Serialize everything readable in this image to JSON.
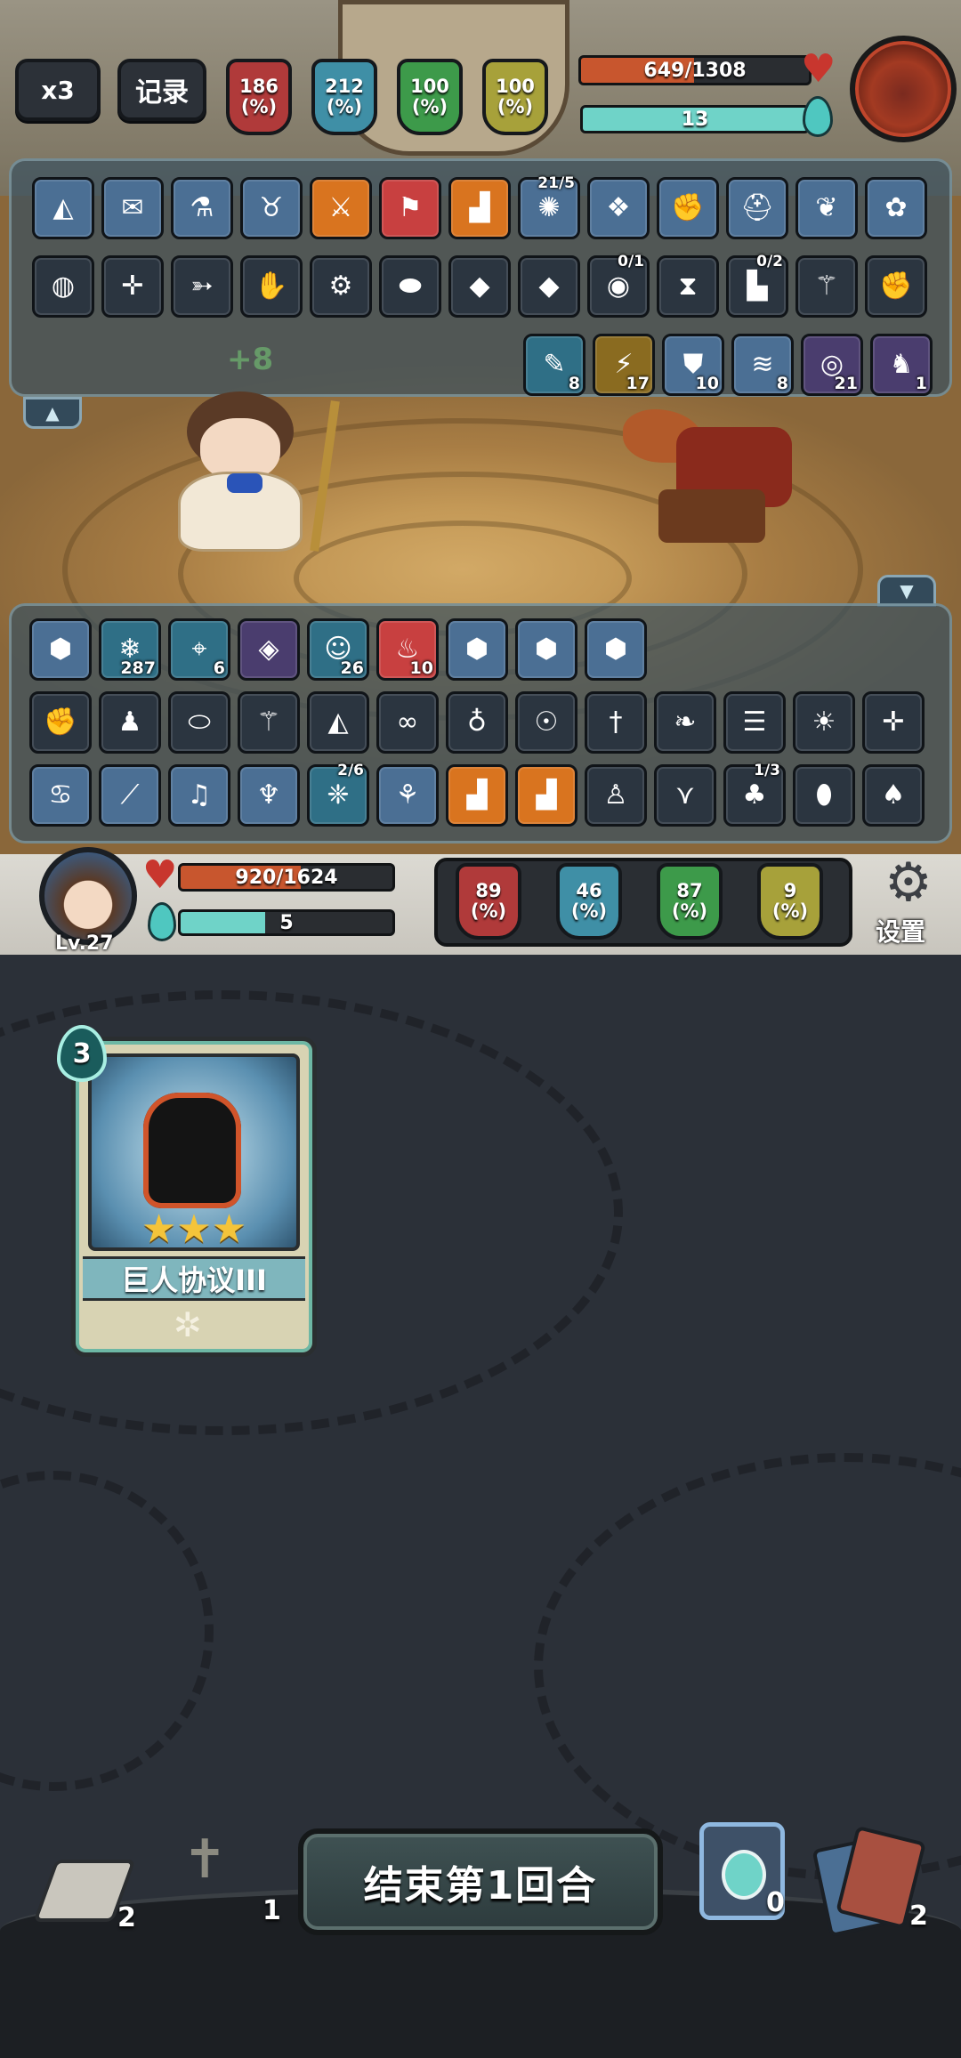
{
  "top": {
    "speed_label": "x3",
    "log_label": "记录",
    "enemy_stats": [
      {
        "value": "186",
        "unit": "(%)",
        "color": "#b03a3a",
        "icon": "attack-icon"
      },
      {
        "value": "212",
        "unit": "(%)",
        "color": "#3f8fa6",
        "icon": "crit-icon"
      },
      {
        "value": "100",
        "unit": "(%)",
        "color": "#3d9a4a",
        "icon": "defense-icon"
      },
      {
        "value": "100",
        "unit": "(%)",
        "color": "#a7a13a",
        "icon": "speed-icon"
      }
    ],
    "enemy_hp_text": "649/1308",
    "enemy_hp_ratio": 0.496,
    "enemy_energy_text": "13",
    "enemy_energy_ratio": 1.0
  },
  "enemy_panel": {
    "row1": [
      {
        "icon": "rice-ball-icon",
        "style": "blue"
      },
      {
        "icon": "scroll-icon",
        "style": "blue"
      },
      {
        "icon": "potion-icon",
        "style": "blue"
      },
      {
        "icon": "minotaur-icon",
        "style": "blue"
      },
      {
        "icon": "sword-icon",
        "style": "orange"
      },
      {
        "icon": "banner-icon",
        "style": "red"
      },
      {
        "icon": "boot-icon",
        "style": "orange"
      },
      {
        "icon": "swirl-icon",
        "style": "blue",
        "frac": "21/5"
      },
      {
        "icon": "rune-icon",
        "style": "blue"
      },
      {
        "icon": "fist-rune-icon",
        "style": "blue"
      },
      {
        "icon": "helmet-rune-icon",
        "style": "blue"
      },
      {
        "icon": "wing-rune-icon",
        "style": "blue"
      },
      {
        "icon": "fairy-rune-icon",
        "style": "blue"
      }
    ],
    "row2": [
      {
        "icon": "pumpkin-icon",
        "style": "dark"
      },
      {
        "icon": "crossbow-icon",
        "style": "dark"
      },
      {
        "icon": "fish-icon",
        "style": "dark"
      },
      {
        "icon": "red-glove-icon",
        "style": "dark"
      },
      {
        "icon": "robot-icon",
        "style": "dark"
      },
      {
        "icon": "red-capsule-icon",
        "style": "dark"
      },
      {
        "icon": "green-gem-icon",
        "style": "dark"
      },
      {
        "icon": "green-gem-icon",
        "style": "dark"
      },
      {
        "icon": "pacifier-icon",
        "style": "dark",
        "frac": "0/1"
      },
      {
        "icon": "hourglass-icon",
        "style": "dark"
      },
      {
        "icon": "boots-icon",
        "style": "dark",
        "frac": "0/2"
      },
      {
        "icon": "staff-icon",
        "style": "dark"
      },
      {
        "icon": "gauntlet-icon",
        "style": "dark"
      }
    ],
    "effects": [
      {
        "icon": "pen-icon",
        "count": "8",
        "style": "cyan"
      },
      {
        "icon": "lightning-icon",
        "count": "17",
        "style": "gold"
      },
      {
        "icon": "shield-icon",
        "count": "10",
        "style": "blue"
      },
      {
        "icon": "wave-icon",
        "count": "8",
        "style": "blue"
      },
      {
        "icon": "spiral-icon",
        "count": "21",
        "style": "purple"
      },
      {
        "icon": "strength-icon",
        "count": "1",
        "style": "purple"
      }
    ]
  },
  "battle": {
    "floating_text": "+8"
  },
  "player_panel": {
    "effects": [
      {
        "icon": "gem-shield-icon",
        "count": "",
        "style": "blue"
      },
      {
        "icon": "snowflake-icon",
        "count": "287",
        "style": "cyan"
      },
      {
        "icon": "target-icon",
        "count": "6",
        "style": "cyan"
      },
      {
        "icon": "crystal-icon",
        "count": "",
        "style": "purple"
      },
      {
        "icon": "face-icon",
        "count": "26",
        "style": "cyan"
      },
      {
        "icon": "rage-icon",
        "count": "10",
        "style": "red"
      },
      {
        "icon": "gem-shield-icon",
        "count": "",
        "style": "blue"
      },
      {
        "icon": "gem-shield-icon",
        "count": "",
        "style": "blue"
      },
      {
        "icon": "gem-shield-icon",
        "count": "",
        "style": "blue"
      }
    ],
    "row2": [
      {
        "icon": "gauntlet-icon",
        "style": "dark"
      },
      {
        "icon": "figure-icon",
        "style": "dark"
      },
      {
        "icon": "bread-icon",
        "style": "dark"
      },
      {
        "icon": "staff-icon",
        "style": "dark"
      },
      {
        "icon": "rice-ball-icon",
        "style": "dark"
      },
      {
        "icon": "goggles-icon",
        "style": "dark"
      },
      {
        "icon": "bottle-icon",
        "style": "dark"
      },
      {
        "icon": "owl-icon",
        "style": "dark"
      },
      {
        "icon": "dagger-icon",
        "style": "dark"
      },
      {
        "icon": "leaf-icon",
        "style": "dark"
      },
      {
        "icon": "mummy-icon",
        "style": "dark"
      },
      {
        "icon": "sun-orb-icon",
        "style": "dark"
      },
      {
        "icon": "crossbow-icon",
        "style": "dark"
      }
    ],
    "row3": [
      {
        "icon": "monster-rune-icon",
        "style": "blue"
      },
      {
        "icon": "wand-rune-icon",
        "style": "blue"
      },
      {
        "icon": "piano-rune-icon",
        "style": "blue"
      },
      {
        "icon": "demon-rune-icon",
        "style": "blue"
      },
      {
        "icon": "bird-rune-icon",
        "style": "cyan",
        "frac": "2/6"
      },
      {
        "icon": "claw-rune-icon",
        "style": "blue"
      },
      {
        "icon": "boot-icon",
        "style": "orange"
      },
      {
        "icon": "boot-icon",
        "style": "orange"
      },
      {
        "icon": "doll-icon",
        "style": "dark"
      },
      {
        "icon": "wing-icon",
        "style": "dark"
      },
      {
        "icon": "plant-icon",
        "style": "dark",
        "frac": "1/3"
      },
      {
        "icon": "egg-icon",
        "style": "dark"
      },
      {
        "icon": "mushroom-icon",
        "style": "dark"
      }
    ]
  },
  "player": {
    "level": "Lv.27",
    "hp_text": "920/1624",
    "hp_ratio": 0.567,
    "energy_text": "5",
    "energy_ratio": 0.4,
    "stats": [
      {
        "value": "89",
        "unit": "(%)",
        "color": "#b03a3a",
        "icon": "attack-icon"
      },
      {
        "value": "46",
        "unit": "(%)",
        "color": "#3f8fa6",
        "icon": "crit-icon"
      },
      {
        "value": "87",
        "unit": "(%)",
        "color": "#3d9a4a",
        "icon": "defense-icon"
      },
      {
        "value": "9",
        "unit": "(%)",
        "color": "#a7a13a",
        "icon": "speed-icon"
      }
    ],
    "settings_label": "设置"
  },
  "hand": {
    "card": {
      "cost": "3",
      "name": "巨人协议III",
      "stars": 3,
      "icon": "fist-icon"
    }
  },
  "bottom": {
    "draw_pile_count": "2",
    "graveyard_count": "1",
    "end_turn_label": "结束第1回合",
    "potion_count": "0",
    "discard_pile_count": "2"
  }
}
